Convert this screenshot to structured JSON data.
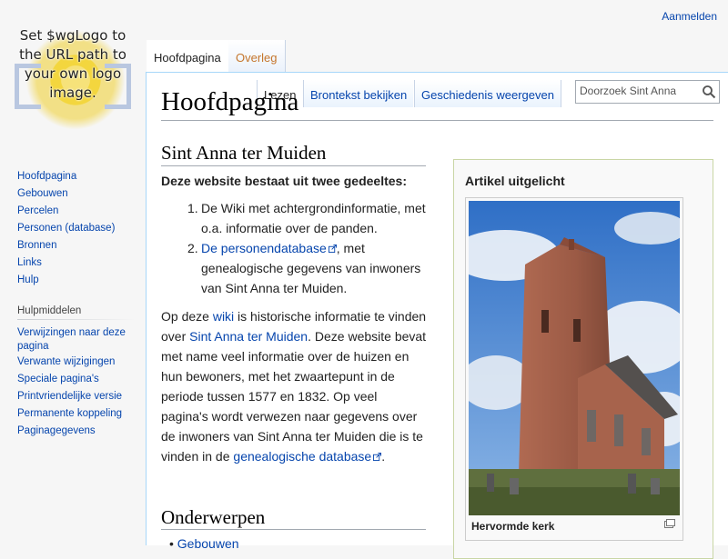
{
  "personal": {
    "login": "Aanmelden"
  },
  "logo": {
    "text": "Set $wgLogo to the URL path to your own logo image."
  },
  "tabs": {
    "main": "Hoofdpagina",
    "talk": "Overleg"
  },
  "views": {
    "read": "Lezen",
    "edit": "Brontekst bekijken",
    "history": "Geschiedenis weergeven"
  },
  "search": {
    "placeholder": "Doorzoek Sint Anna"
  },
  "page": {
    "title": "Hoofdpagina",
    "section1_title": "Sint Anna ter Muiden",
    "intro_bold": "Deze website bestaat uit twee gedeeltes:",
    "list": [
      {
        "num": "1.",
        "text": "De Wiki met achtergrondinformatie, met o.a. informatie over de panden."
      },
      {
        "num": "2.",
        "link": "De personendatabase",
        "text": ", met genealogische gegevens van inwoners van Sint Anna ter Muiden."
      }
    ],
    "paragraph": {
      "p1": "Op deze ",
      "link_wiki": "wiki",
      "p2": " is historische informatie te vinden over ",
      "link_place": "Sint Anna ter Muiden",
      "p3": ". Deze website bevat met name veel informatie over de huizen en hun bewoners, met het zwaartepunt in de periode tussen 1577 en 1832. Op veel pagina's wordt verwezen naar gegevens over de inwoners van Sint Anna ter Muiden die is te vinden in de ",
      "link_db": "genealogische database",
      "p4": "."
    },
    "section2_title": "Onderwerpen",
    "bullet_first": "Gebouwen"
  },
  "featured": {
    "title": "Artikel uitgelicht",
    "caption": "Hervormde kerk"
  },
  "sidebar": {
    "nav": [
      "Hoofdpagina",
      "Gebouwen",
      "Percelen",
      "Personen (database)",
      "Bronnen",
      "Links",
      "Hulp"
    ],
    "tools_heading": "Hulpmiddelen",
    "tools": [
      "Verwijzingen naar deze pagina",
      "Verwante wijzigingen",
      "Speciale pagina's",
      "Printvriendelijke versie",
      "Permanente koppeling",
      "Paginagegevens"
    ]
  },
  "colors": {
    "link": "#0645ad",
    "border": "#a7d7f9",
    "featured_border": "#c9d6a5"
  },
  "icons": {
    "search": "magnifier-icon",
    "external": "external-link-icon",
    "enlarge": "enlarge-icon"
  }
}
